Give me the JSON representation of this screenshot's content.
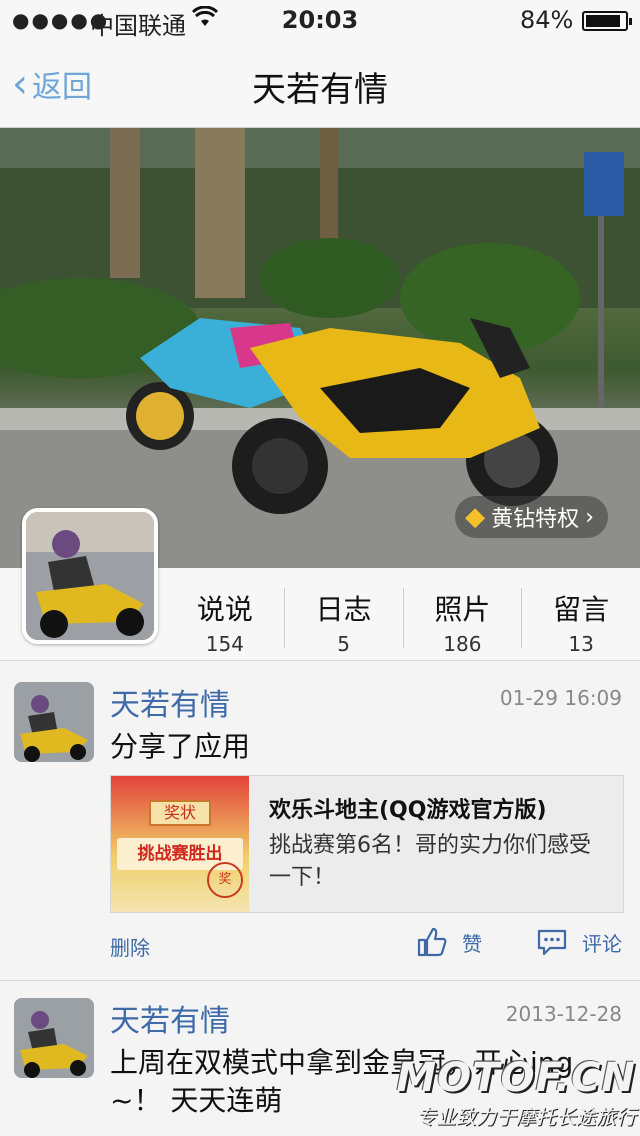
{
  "status_bar": {
    "signal": "●●●●●",
    "carrier": "中国联通",
    "time": "20:03",
    "battery": "84%"
  },
  "nav": {
    "back_label": "返回",
    "title": "天若有情"
  },
  "cover": {
    "vip_label": "黄钻特权"
  },
  "stats": [
    {
      "label": "说说",
      "value": "154"
    },
    {
      "label": "日志",
      "value": "5"
    },
    {
      "label": "照片",
      "value": "186"
    },
    {
      "label": "留言",
      "value": "13"
    }
  ],
  "posts": [
    {
      "author": "天若有情",
      "time": "01-29 16:09",
      "text": "分享了应用",
      "share": {
        "thumb_top": "奖状",
        "thumb_banner": "挑战赛胜出",
        "thumb_seal": "奖",
        "title": "欢乐斗地主(QQ游戏官方版)",
        "desc": "挑战赛第6名！哥的实力你们感受一下！"
      },
      "actions": {
        "delete": "删除",
        "like": "赞",
        "comment": "评论"
      }
    },
    {
      "author": "天若有情",
      "time": "2013-12-28",
      "text": "上周在双模式中拿到金皇冠，开心ing ~！ 天天连萌"
    }
  ],
  "watermark": {
    "main": "MOTOF.CN",
    "sub": "专业致力于摩托长途旅行"
  },
  "colors": {
    "link_blue": "#3e6aa8",
    "nav_back": "#6fa6d8",
    "vip_gold": "#f5c028"
  }
}
